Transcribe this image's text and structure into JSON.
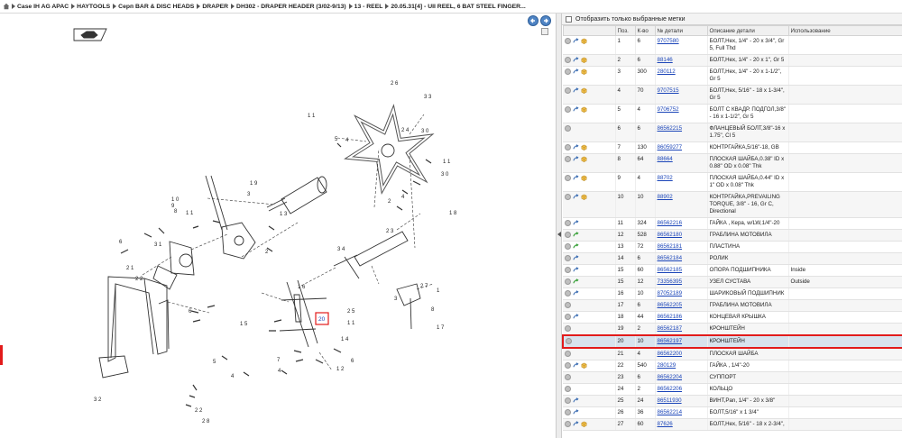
{
  "breadcrumb": [
    "Case IH AG APAC",
    "HAYTOOLS",
    "Серп BAR & DISC HEADS",
    "DRAPER",
    "DH302 - DRAPER HEADER (3/02-9/13)",
    "13 - REEL",
    "20.05.31[4] - UII REEL, 6 BAT STEEL FINGER..."
  ],
  "filter": {
    "label": "Отобразить только выбранные метки"
  },
  "table": {
    "headers": [
      "",
      "Поз.",
      "К-во",
      "№ детали",
      "Описание детали",
      "Использование"
    ],
    "rows": [
      {
        "pos": "1",
        "qty": "6",
        "pn": "9707580",
        "desc": "БОЛТ,Hex, 1/4\" - 20 x 3/4\", Gr 5, Full Thd",
        "use": "",
        "icons": "full"
      },
      {
        "pos": "2",
        "qty": "6",
        "pn": "88146",
        "desc": "БОЛТ,Hex, 1/4\" - 20 x 1\", Gr 5",
        "use": "",
        "icons": "full"
      },
      {
        "pos": "3",
        "qty": "300",
        "pn": "280112",
        "desc": "БОЛТ,Hex, 1/4\" - 20 x 1-1/2\", Gr 5",
        "use": "",
        "icons": "full"
      },
      {
        "pos": "4",
        "qty": "70",
        "pn": "9707515",
        "desc": "БОЛТ,Hex, 5/16\" - 18 x 1-3/4\", Gr 5",
        "use": "",
        "icons": "full"
      },
      {
        "pos": "5",
        "qty": "4",
        "pn": "9706752",
        "desc": "БОЛТ С КВАДР. ПОДГОЛ,3/8\" - 16 x 1-1/2\", Gr 5",
        "use": "",
        "icons": "full"
      },
      {
        "pos": "6",
        "qty": "6",
        "pn": "86562215",
        "desc": "ФЛАНЦЕВЫЙ БОЛТ,3/8\"-16 x 1.75\", Cl 5",
        "use": "",
        "icons": "info"
      },
      {
        "pos": "7",
        "qty": "130",
        "pn": "86059277",
        "desc": "КОНТРГАЙКА,5/16\"-18, GB",
        "use": "",
        "icons": "full"
      },
      {
        "pos": "8",
        "qty": "64",
        "pn": "88664",
        "desc": "ПЛОСКАЯ ШАЙБА,0.38\" ID x 0.88\" OD x 0.08\" Thk",
        "use": "",
        "icons": "full"
      },
      {
        "pos": "9",
        "qty": "4",
        "pn": "88702",
        "desc": "ПЛОСКАЯ ШАЙБА,0.44\" ID x 1\" OD x 0.08\" Thk",
        "use": "",
        "icons": "full"
      },
      {
        "pos": "10",
        "qty": "10",
        "pn": "88902",
        "desc": "КОНТРГАЙКА,PREVAILING TORQUE, 3/8\" - 16, Gr C, Directional",
        "use": "",
        "icons": "full"
      },
      {
        "pos": "11",
        "qty": "324",
        "pn": "86562216",
        "desc": "ГАЙКА , Кера, w/LW,1/4\"-20",
        "use": "",
        "icons": "link"
      },
      {
        "pos": "12",
        "qty": "528",
        "pn": "86562180",
        "desc": "ГРАБЛИНА МОТОВИЛА",
        "use": "",
        "icons": "green"
      },
      {
        "pos": "13",
        "qty": "72",
        "pn": "86562181",
        "desc": "ПЛАСТИНА",
        "use": "",
        "icons": "green"
      },
      {
        "pos": "14",
        "qty": "6",
        "pn": "86562184",
        "desc": "РОЛИК",
        "use": "",
        "icons": "link"
      },
      {
        "pos": "15",
        "qty": "60",
        "pn": "86562185",
        "desc": "ОПОРА ПОДШИПНИКА",
        "use": "Inside",
        "icons": "link"
      },
      {
        "pos": "15",
        "qty": "12",
        "pn": "73356395",
        "desc": "УЗЕЛ СУСТАВА",
        "use": "Outside",
        "icons": "green"
      },
      {
        "pos": "16",
        "qty": "10",
        "pn": "87052189",
        "desc": "ШАРИКОВЫЙ ПОДШИПНИК",
        "use": "",
        "icons": "link"
      },
      {
        "pos": "17",
        "qty": "6",
        "pn": "86562205",
        "desc": "ГРАБЛИНА МОТОВИЛА",
        "use": "",
        "icons": "info"
      },
      {
        "pos": "18",
        "qty": "44",
        "pn": "86562186",
        "desc": "КОНЦЕВАЯ КРЫШКА",
        "use": "",
        "icons": "link"
      },
      {
        "pos": "19",
        "qty": "2",
        "pn": "86562187",
        "desc": "КРОНШТЕЙН",
        "use": "",
        "icons": "info"
      },
      {
        "pos": "20",
        "qty": "10",
        "pn": "86562197",
        "desc": "КРОНШТЕЙН",
        "use": "",
        "icons": "info",
        "selected": true
      },
      {
        "pos": "21",
        "qty": "4",
        "pn": "86562200",
        "desc": "ПЛОСКАЯ ШАЙБА",
        "use": "",
        "icons": "info"
      },
      {
        "pos": "22",
        "qty": "540",
        "pn": "280129",
        "desc": "ГАЙКА , 1/4\"-20",
        "use": "",
        "icons": "full"
      },
      {
        "pos": "23",
        "qty": "6",
        "pn": "86562204",
        "desc": "СУППОРТ",
        "use": "",
        "icons": "info"
      },
      {
        "pos": "24",
        "qty": "2",
        "pn": "86562206",
        "desc": "КОЛЬЦО",
        "use": "",
        "icons": "info"
      },
      {
        "pos": "25",
        "qty": "24",
        "pn": "86511930",
        "desc": "ВИНТ,Pan, 1/4\" - 20 x 3/8\"",
        "use": "",
        "icons": "link"
      },
      {
        "pos": "26",
        "qty": "36",
        "pn": "86562214",
        "desc": "БОЛТ,5/16\" x 1 3/4\"",
        "use": "",
        "icons": "link"
      },
      {
        "pos": "27",
        "qty": "60",
        "pn": "87626",
        "desc": "БОЛТ,Hex, 5/16\" - 18 x 2-3/4\",",
        "use": "",
        "icons": "full"
      }
    ]
  },
  "diagram": {
    "callouts": [
      "1",
      "2",
      "3",
      "4",
      "5",
      "6",
      "7",
      "8",
      "9",
      "10",
      "11",
      "12",
      "13",
      "14",
      "15",
      "16",
      "17",
      "18",
      "19",
      "20",
      "21",
      "22",
      "23",
      "24",
      "25",
      "26",
      "27",
      "28",
      "29",
      "30",
      "31",
      "32",
      "33",
      "34"
    ],
    "highlighted_callout": "20"
  },
  "colors": {
    "selection_outline": "#e21b1b",
    "link": "#1a44b8",
    "nav_button": "#4f84c4"
  }
}
